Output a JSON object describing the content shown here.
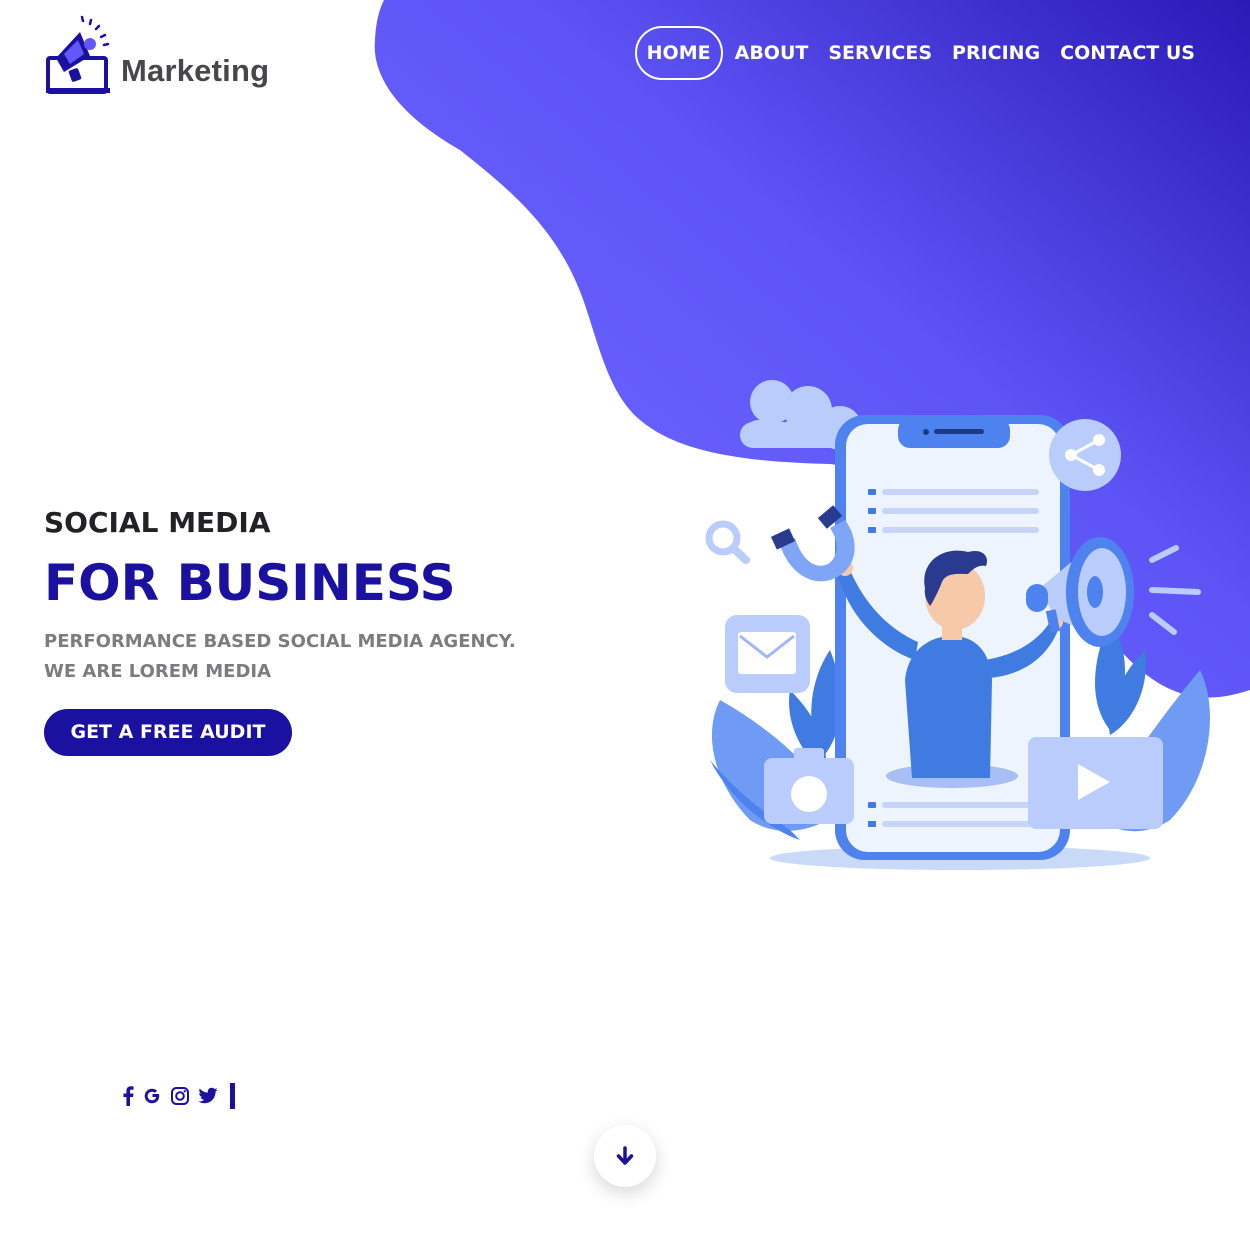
{
  "brand": {
    "name": "Marketing",
    "logo_icon": "megaphone-laptop-icon"
  },
  "nav": {
    "items": [
      {
        "label": "HOME",
        "active": true
      },
      {
        "label": "ABOUT",
        "active": false
      },
      {
        "label": "SERVICES",
        "active": false
      },
      {
        "label": "PRICING",
        "active": false
      },
      {
        "label": "CONTACT US",
        "active": false
      }
    ]
  },
  "hero": {
    "kicker": "SOCIAL MEDIA",
    "title": "FOR BUSINESS",
    "description_line1": "PERFORMANCE BASED SOCIAL MEDIA AGENCY.",
    "description_line2": "WE ARE LOREM MEDIA",
    "cta_label": "GET A FREE AUDIT"
  },
  "social": {
    "icons": [
      "facebook-icon",
      "google-icon",
      "instagram-icon",
      "twitter-icon"
    ]
  },
  "scroll": {
    "icon": "arrow-down-icon"
  },
  "colors": {
    "brand_blue": "#1b11a0",
    "gradient_light": "#6157fb",
    "gradient_dark": "#2b1bb8",
    "text_dark": "#222226",
    "text_gray": "#7c7c80",
    "illustration_blue": "#3f7be0",
    "illustration_light": "#b9ccfb"
  }
}
